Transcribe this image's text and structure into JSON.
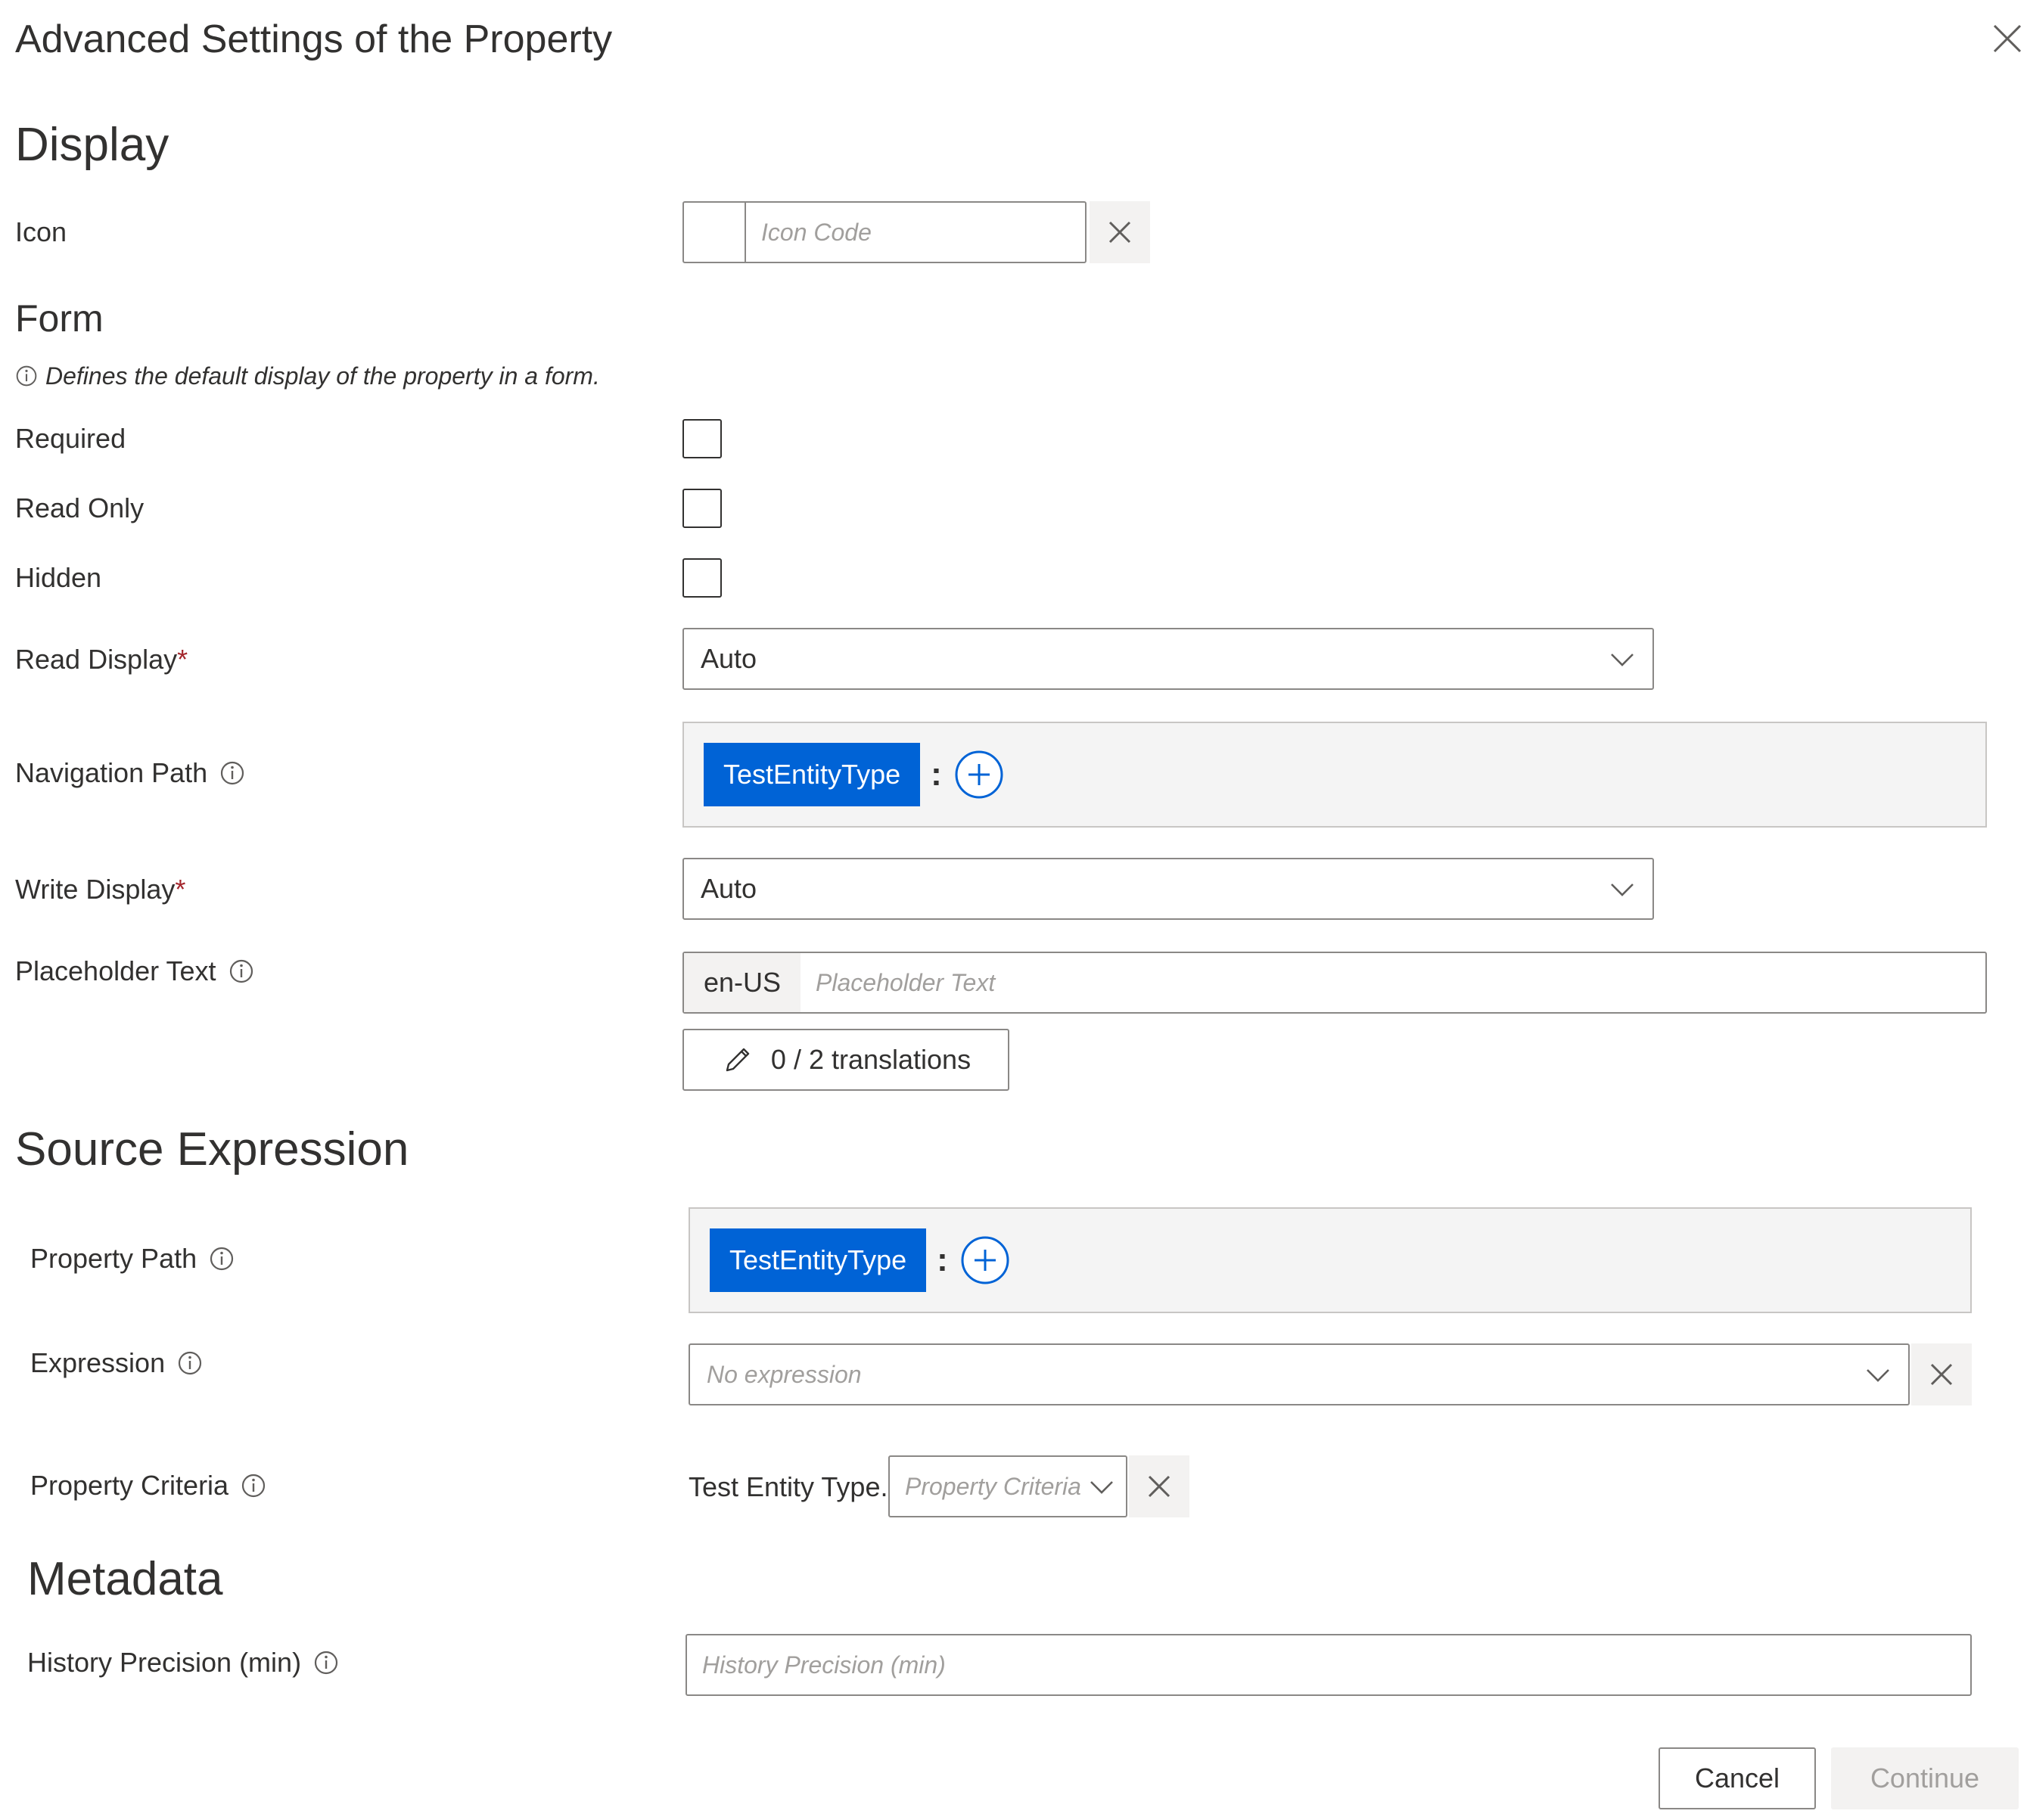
{
  "dialog": {
    "title": "Advanced Settings of the Property"
  },
  "display": {
    "heading": "Display",
    "icon": {
      "label": "Icon",
      "placeholder": "Icon Code"
    }
  },
  "form": {
    "heading": "Form",
    "note": "Defines the default display of the property in a form.",
    "required_label": "Required",
    "readonly_label": "Read Only",
    "hidden_label": "Hidden",
    "read_display": {
      "label": "Read Display",
      "required_mark": "*",
      "value": "Auto"
    },
    "navigation_path": {
      "label": "Navigation Path",
      "chip": "TestEntityType",
      "separator": ":"
    },
    "write_display": {
      "label": "Write Display",
      "required_mark": "*",
      "value": "Auto"
    },
    "placeholder_text": {
      "label": "Placeholder Text",
      "locale": "en-US",
      "placeholder": "Placeholder Text"
    },
    "translations_button": "0 / 2 translations"
  },
  "source_expression": {
    "heading": "Source Expression",
    "property_path": {
      "label": "Property Path",
      "chip": "TestEntityType",
      "separator": ":"
    },
    "expression": {
      "label": "Expression",
      "placeholder": "No expression"
    },
    "property_criteria": {
      "label": "Property Criteria",
      "prefix": "Test Entity Type.",
      "placeholder": "Property Criteria"
    }
  },
  "metadata": {
    "heading": "Metadata",
    "history_precision": {
      "label": "History Precision (min)",
      "placeholder": "History Precision (min)"
    }
  },
  "footer": {
    "cancel_label": "Cancel",
    "continue_label": "Continue"
  },
  "colors": {
    "accent": "#0063d6",
    "required": "#a4262c",
    "disabled_text": "#a19f9d",
    "disabled_bg": "#f3f2f1"
  }
}
